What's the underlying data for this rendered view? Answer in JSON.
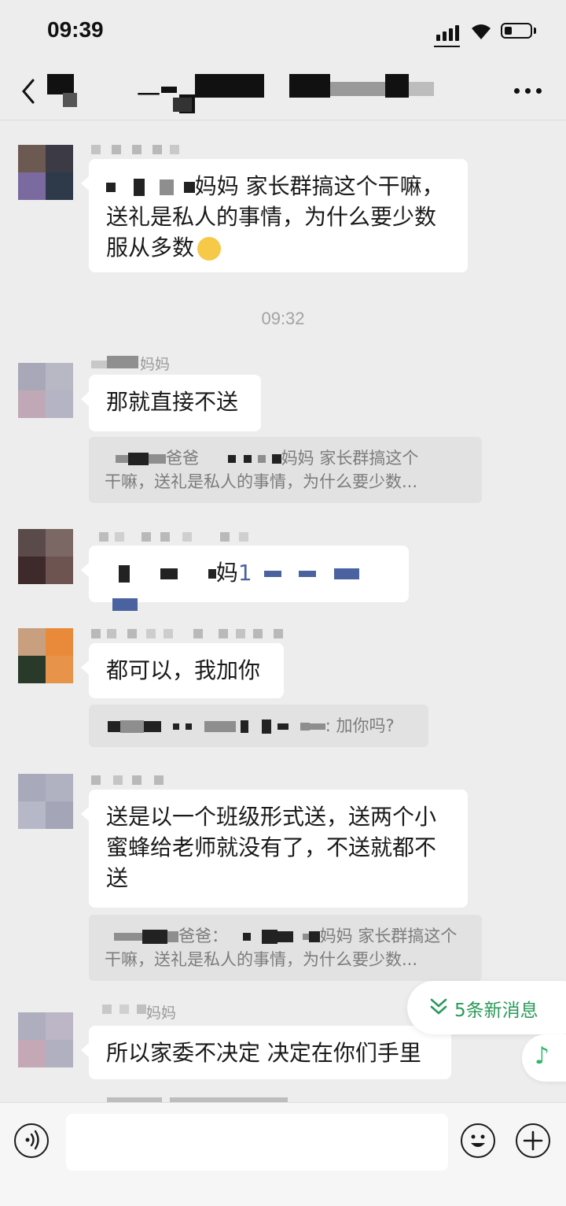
{
  "status_bar": {
    "time": "09:39"
  },
  "nav": {
    "title_partial_1": "一",
    "title_partial_2": ""
  },
  "messages": [
    {
      "text_suffix": "妈妈 家长群搞这个干嘛，送礼是私人的事情，为什么要少数服从多数"
    },
    {
      "sender_suffix": "妈妈",
      "text": "那就直接不送",
      "quote_a": "爸爸",
      "quote_b": "妈妈 家长群搞这个",
      "quote_c": "干嘛，送礼是私人的事情，为什么要少数..."
    },
    {
      "text_a": "妈",
      "text_b": "1"
    },
    {
      "text": "都可以，我加你",
      "quote_text": ": 加你吗?"
    },
    {
      "text": "送是以一个班级形式送，送两个小蜜蜂给老师就没有了，不送就都不送",
      "quote_a": "爸爸：",
      "quote_b": "妈妈 家长群搞这个",
      "quote_c": "干嘛，送礼是私人的事情，为什么要少数..."
    },
    {
      "sender_suffix": "妈妈",
      "text": "所以家委不决定 决定在你们手里"
    }
  ],
  "timestamp": "09:32",
  "new_messages": {
    "label": "5条新消息",
    "color": "#2a9a5a"
  },
  "music_note": "♪",
  "input": {
    "placeholder": ""
  }
}
